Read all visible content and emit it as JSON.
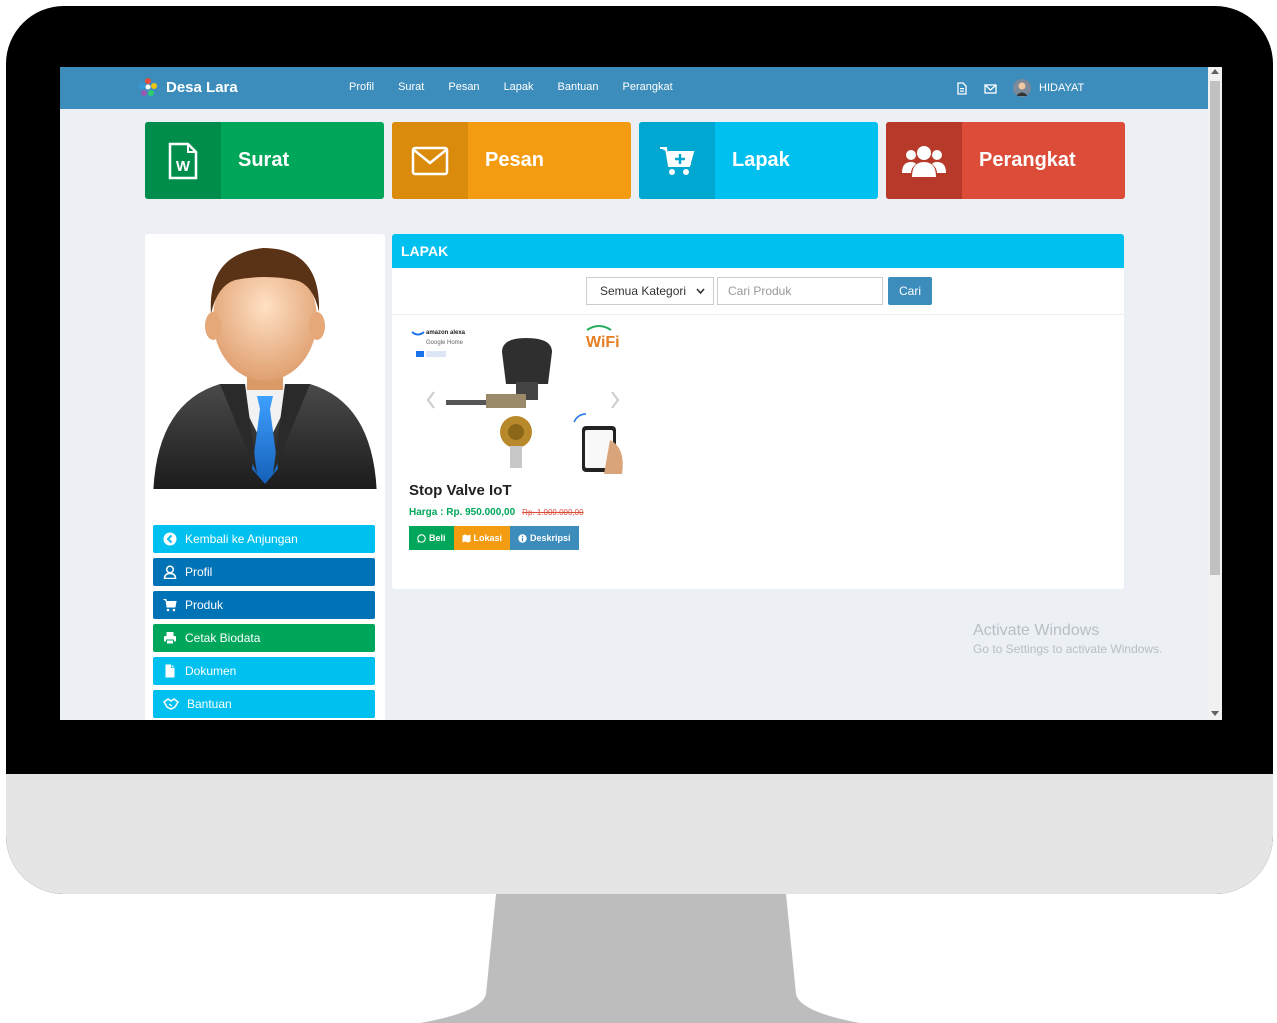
{
  "navbar": {
    "brand": "Desa Lara",
    "links": [
      "Profil",
      "Surat",
      "Pesan",
      "Lapak",
      "Bantuan",
      "Perangkat"
    ],
    "user": "HIDAYAT"
  },
  "tiles": [
    {
      "label": "Surat",
      "icon": "word-file-icon",
      "color": "#00a65a",
      "dark": "#008d4c"
    },
    {
      "label": "Pesan",
      "icon": "envelope-icon",
      "color": "#f39c12",
      "dark": "#db8b0b"
    },
    {
      "label": "Lapak",
      "icon": "cart-plus-icon",
      "color": "#00c0ef",
      "dark": "#00a7d0"
    },
    {
      "label": "Perangkat",
      "icon": "users-icon",
      "color": "#dd4b39",
      "dark": "#c23321"
    }
  ],
  "sidebar": {
    "menu": [
      {
        "label": "Kembali ke Anjungan",
        "icon": "arrow-left-circle-icon",
        "color": "#00c0ef"
      },
      {
        "label": "Profil",
        "icon": "user-icon",
        "color": "#0073b7"
      },
      {
        "label": "Produk",
        "icon": "cart-icon",
        "color": "#0073b7"
      },
      {
        "label": "Cetak Biodata",
        "icon": "print-icon",
        "color": "#00a65a"
      },
      {
        "label": "Dokumen",
        "icon": "file-icon",
        "color": "#00c0ef"
      },
      {
        "label": "Bantuan",
        "icon": "handshake-icon",
        "color": "#00c0ef"
      }
    ]
  },
  "lapak": {
    "title": "LAPAK",
    "category_selected": "Semua Kategori",
    "search_placeholder": "Cari Produk",
    "search_button": "Cari",
    "product": {
      "image_texts": {
        "brand1": "amazon alexa",
        "brand2": "Google Home",
        "badge": "WiFi"
      },
      "name": "Stop Valve IoT",
      "price": "Harga : Rp. 950.000,00",
      "old_price": "Rp. 1.000.000,00",
      "actions": [
        {
          "label": "Beli",
          "icon": "whatsapp-icon",
          "color": "#00a65a"
        },
        {
          "label": "Lokasi",
          "icon": "map-icon",
          "color": "#f39c12"
        },
        {
          "label": "Deskripsi",
          "icon": "info-icon",
          "color": "#3c8dbc"
        }
      ]
    }
  },
  "watermark": {
    "title": "Activate Windows",
    "subtitle": "Go to Settings to activate Windows."
  },
  "colors": {
    "navbar": "#3c8dbc",
    "page_bg": "#ecf0f5",
    "monitor_chin": "#e5e5e5",
    "stand": "#bdbdbd"
  }
}
